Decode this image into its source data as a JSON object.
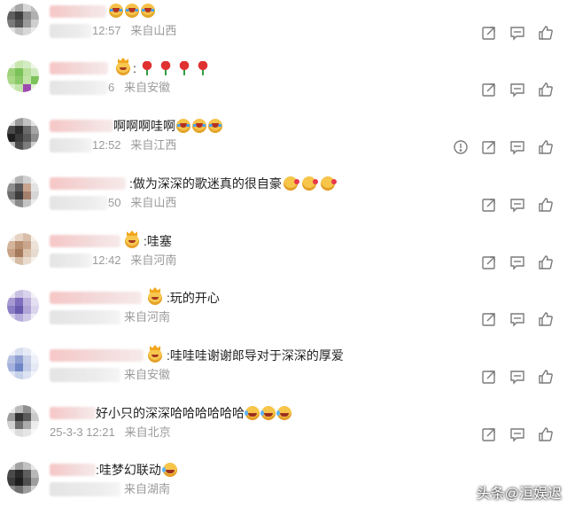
{
  "comments": [
    {
      "text": "",
      "emojis": [
        "crying-emoji",
        "crying-emoji",
        "crying-emoji"
      ],
      "time_visible": "12:57",
      "location": "来自山西",
      "has_report": false
    },
    {
      "text": ":",
      "emojis": [
        "rose-emoji",
        "rose-emoji",
        "rose-emoji",
        "rose-emoji"
      ],
      "time_visible": "6",
      "location": "来自安徽",
      "has_report": false
    },
    {
      "text": "啊啊啊哇啊",
      "emojis": [
        "crying-emoji",
        "crying-emoji",
        "crying-emoji"
      ],
      "time_visible": "12:52",
      "location": "来自江西",
      "has_report": true
    },
    {
      "text": ":做为深深的歌迷真的很自豪",
      "emojis": [
        "kiss-emoji",
        "kiss-emoji",
        "kiss-emoji"
      ],
      "time_visible": "50",
      "location": "来自山西",
      "has_report": false
    },
    {
      "text": ":哇塞",
      "emojis": [],
      "time_visible": "12:42",
      "location": "来自河南",
      "has_report": false
    },
    {
      "text": ":玩的开心",
      "emojis": [],
      "time_visible": "",
      "location": "来自河南",
      "has_report": false
    },
    {
      "text": ":哇哇哇谢谢郎导对于深深的厚爱",
      "emojis": [],
      "time_visible": "",
      "location": "来自安徽",
      "has_report": false
    },
    {
      "text": "好小只的深深哈哈哈哈哈哈",
      "emojis": [
        "laughing-emoji",
        "laughing-emoji",
        "laughing-emoji"
      ],
      "time_visible": "25-3-3  12:21",
      "location": "来自北京",
      "has_report": false
    },
    {
      "text": ":哇梦幻联动",
      "emojis": [
        "laughing-emoji"
      ],
      "time_visible": "",
      "location": "来自湖南",
      "has_report": false
    }
  ],
  "watermark": "头条@洹娱迟",
  "colors": {
    "meta_text": "#9a9a9a",
    "icon_stroke": "#7a7a7a",
    "name_blur": "#f6c6c6"
  },
  "action_icons": [
    "reply-icon",
    "comment-icon",
    "like-icon"
  ],
  "report_icon": "report-icon"
}
